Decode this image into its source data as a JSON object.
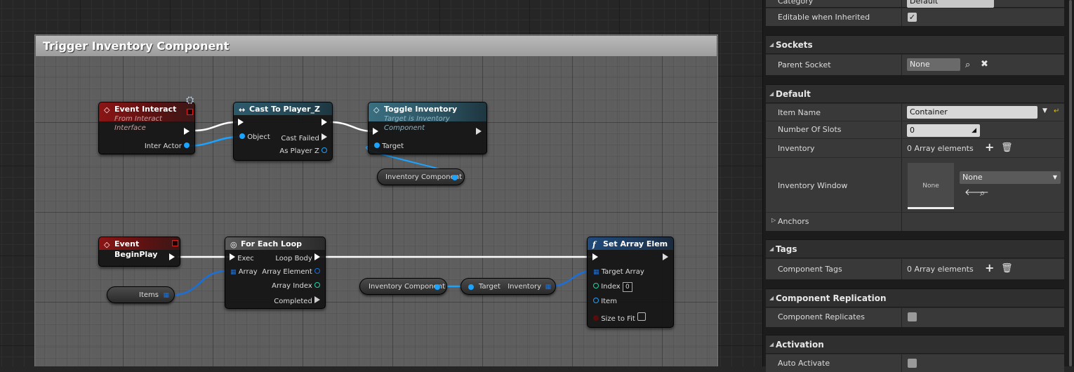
{
  "comment": {
    "title": "Trigger Inventory Component"
  },
  "nodes": {
    "event_interact": {
      "title": "Event Interact",
      "subtitle": "From Interact Interface",
      "pin_inter_actor": "Inter Actor"
    },
    "cast": {
      "title": "Cast To Player_Z",
      "pin_object": "Object",
      "pin_cast_failed": "Cast Failed",
      "pin_as_player": "As Player Z"
    },
    "toggle": {
      "title": "Toggle Inventory",
      "subtitle": "Target is Inventory Component",
      "pin_target": "Target"
    },
    "inv_comp_var_1": {
      "label": "Inventory Component"
    },
    "event_beginplay": {
      "title": "Event BeginPlay"
    },
    "foreach": {
      "title": "For Each Loop",
      "pin_exec": "Exec",
      "pin_array": "Array",
      "pin_loop_body": "Loop Body",
      "pin_array_element": "Array Element",
      "pin_array_index": "Array Index",
      "pin_completed": "Completed"
    },
    "items_var": {
      "label": "Items"
    },
    "inv_comp_var_2": {
      "label": "Inventory Component"
    },
    "get_inventory": {
      "pin_target": "Target",
      "pin_inventory": "Inventory"
    },
    "set_array": {
      "title": "Set Array Elem",
      "pin_target_array": "Target Array",
      "pin_index": "Index",
      "index_value": "0",
      "pin_item": "Item",
      "pin_size_to_fit": "Size to Fit"
    }
  },
  "details": {
    "top": {
      "category_label": "Category",
      "category_value": "Default",
      "editable_label": "Editable when Inherited",
      "editable_checked": true
    },
    "sockets": {
      "header": "Sockets",
      "parent_socket_label": "Parent Socket",
      "parent_socket_value": "None"
    },
    "default": {
      "header": "Default",
      "item_name_label": "Item Name",
      "item_name_value": "Container",
      "slots_label": "Number Of Slots",
      "slots_value": "0",
      "inventory_label": "Inventory",
      "inventory_value": "0 Array elements",
      "window_label": "Inventory Window",
      "window_thumb": "None",
      "window_value": "None",
      "anchors_label": "Anchors"
    },
    "tags": {
      "header": "Tags",
      "component_tags_label": "Component Tags",
      "component_tags_value": "0 Array elements"
    },
    "replication": {
      "header": "Component Replication",
      "replicates_label": "Component Replicates",
      "replicates_checked": false
    },
    "activation": {
      "header": "Activation",
      "auto_activate_label": "Auto Activate"
    }
  },
  "colors": {
    "exec_wire": "#ffffff",
    "object_wire": "#1aa3ff",
    "event_header": "#8b1515",
    "function_header": "#1f4a7a"
  }
}
